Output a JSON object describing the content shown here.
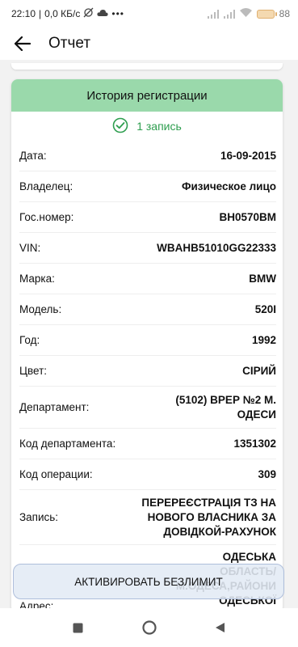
{
  "status_bar": {
    "time": "22:10",
    "network_speed": "0,0 КБ/с",
    "battery_level": "88"
  },
  "app_bar": {
    "title": "Отчет"
  },
  "card": {
    "title": "История регистрации",
    "records_count": "1 запись",
    "accent_color": "#2e9e4f",
    "header_color": "#9ad9ab",
    "rows": [
      {
        "label": "Дата:",
        "value": "16-09-2015"
      },
      {
        "label": "Владелец:",
        "value": "Физическое лицо"
      },
      {
        "label": "Гос.номер:",
        "value": "BH0570BM"
      },
      {
        "label": "VIN:",
        "value": "WBAHB51010GG22333"
      },
      {
        "label": "Марка:",
        "value": "BMW"
      },
      {
        "label": "Модель:",
        "value": "520I"
      },
      {
        "label": "Год:",
        "value": "1992"
      },
      {
        "label": "Цвет:",
        "value": "СІРИЙ"
      },
      {
        "label": "Департамент:",
        "value": "(5102) ВРЕР №2 М. ОДЕСИ"
      },
      {
        "label": "Код департамента:",
        "value": "1351302"
      },
      {
        "label": "Код операции:",
        "value": "309"
      },
      {
        "label": "Запись:",
        "value": "ПЕРЕРЕЄСТРАЦІЯ ТЗ НА НОВОГО ВЛАСНИКА ЗА ДОВІДКОЙ-РАХУНОК"
      },
      {
        "label": "Адрес:",
        "value": "ОДЕСЬКА ОБЛАСТЬ/ М.ОДЕСА,РАЙОНИ ОДЕСЬКОЇ ОБЛАСТІ,БІЛЯЇВСЬКИЙ РАЙОН/"
      }
    ]
  },
  "cta": {
    "label": "АКТИВИРОВАТЬ БЕЗЛИМИТ"
  },
  "icons": {
    "back": "arrow-left-icon",
    "check": "check-circle-icon",
    "nav_recent": "square-icon",
    "nav_home": "circle-icon",
    "nav_back": "triangle-back-icon"
  }
}
